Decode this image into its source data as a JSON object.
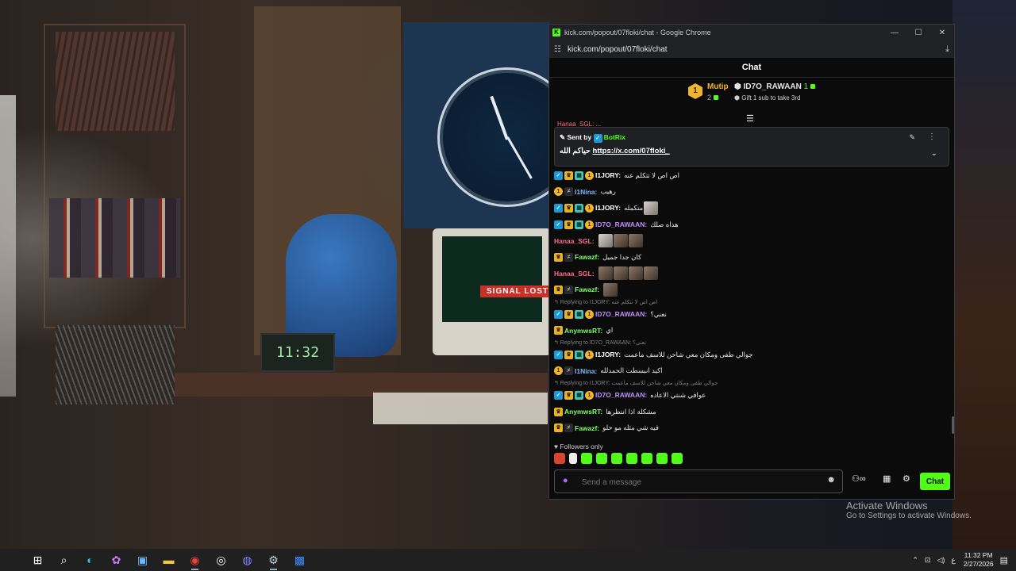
{
  "desktop": {
    "computer_sign": "SIGNAL LOST",
    "digital_clock": "11:32",
    "activate_title": "Activate Windows",
    "activate_sub": "Go to Settings to activate Windows."
  },
  "window": {
    "title": "kick.com/popout/07floki/chat - Google Chrome",
    "url": "kick.com/popout/07floki/chat",
    "controls": [
      "—",
      "☐",
      "✕"
    ]
  },
  "chat": {
    "header": "Chat",
    "leaderboard": {
      "first_rank": "1",
      "first_name": "Mutip",
      "first_count": "2",
      "second_name": "ID7O_RAWAAN",
      "second_count": "1",
      "gift_text": "Gift 1 sub to take 3rd"
    },
    "cut_text": "Hanaa_SGL: ...",
    "pinned": {
      "sent_by": "Sent by",
      "bot_name": "BotRix",
      "text_ar": "حياكم الله",
      "link": "https://x.com/07floki_"
    },
    "messages": [
      {
        "kind": "msg",
        "badges": [
          "verify",
          "crown",
          "gift",
          "coin"
        ],
        "user": "I1JORY:",
        "color": "#ffffff",
        "text": "اص اص لا تتكلم عنه"
      },
      {
        "kind": "msg",
        "badges": [
          "coin",
          "og"
        ],
        "user": "I1Nina:",
        "color": "#7fb8ff",
        "text": "رهيب"
      },
      {
        "kind": "msg",
        "badges": [
          "verify",
          "crown",
          "gift",
          "coin"
        ],
        "user": "I1JORY:",
        "color": "#ffffff",
        "text": "متكمله",
        "emotes": [
          "pale"
        ]
      },
      {
        "kind": "msg",
        "badges": [
          "verify",
          "crown",
          "gift",
          "coin"
        ],
        "user": "ID7O_RAWAAN:",
        "color": "#c08cff",
        "text": "هذاه صلك"
      },
      {
        "kind": "msg",
        "badges": [],
        "user": "Hanaa_SGL:",
        "color": "#ff6b8a",
        "text": "",
        "emotes": [
          "pale",
          "",
          ""
        ]
      },
      {
        "kind": "msg",
        "badges": [
          "crown",
          "og"
        ],
        "user": "Fawazf:",
        "color": "#7dff6a",
        "text": "كان جدا جميل"
      },
      {
        "kind": "msg",
        "badges": [],
        "user": "Hanaa_SGL:",
        "color": "#ff6b8a",
        "text": "",
        "emotes": [
          "",
          "",
          "",
          ""
        ]
      },
      {
        "kind": "msg",
        "badges": [
          "crown",
          "og"
        ],
        "user": "Fawazf:",
        "color": "#7dff6a",
        "text": "",
        "emotes": [
          ""
        ]
      },
      {
        "kind": "reply",
        "text": "↰ Replying to I1JORY: اص اص لا تتكلم عنه"
      },
      {
        "kind": "msg",
        "badges": [
          "verify",
          "crown",
          "gift",
          "coin"
        ],
        "user": "ID7O_RAWAAN:",
        "color": "#c08cff",
        "text": "نعني؟"
      },
      {
        "kind": "msg",
        "badges": [
          "crown"
        ],
        "user": "AnymwsRT:",
        "color": "#7dff6a",
        "text": "اي"
      },
      {
        "kind": "reply",
        "text": "↰ Replying to ID7O_RAWAAN: نعني؟"
      },
      {
        "kind": "msg",
        "badges": [
          "verify",
          "crown",
          "gift",
          "coin"
        ],
        "user": "I1JORY:",
        "color": "#ffffff",
        "text": "جوالي طفى ومكان معي شاحن للاسف ماعمت"
      },
      {
        "kind": "msg",
        "badges": [
          "coin",
          "og"
        ],
        "user": "I1Nina:",
        "color": "#7fb8ff",
        "text": "اكيد انبسطت الحمدلله"
      },
      {
        "kind": "reply",
        "text": "↰ Replying to I1JORY: جوالي طفى ومكان معي شاحن للاسف ماعمت"
      },
      {
        "kind": "msg",
        "badges": [
          "verify",
          "crown",
          "gift",
          "coin"
        ],
        "user": "ID7O_RAWAAN:",
        "color": "#c08cff",
        "text": "عوافي شنتي الاعاده"
      },
      {
        "kind": "msg",
        "badges": [
          "crown"
        ],
        "user": "AnymwsRT:",
        "color": "#7dff6a",
        "text": "مشكلة اذا انتظرها"
      },
      {
        "kind": "msg",
        "badges": [
          "crown",
          "og"
        ],
        "user": "Fawazf:",
        "color": "#7dff6a",
        "text": "فيه شي مثله مو حلو"
      }
    ],
    "followers_only": "Followers only",
    "input_placeholder": "Send a message",
    "send_label": "Chat"
  },
  "taskbar": {
    "time": "11:32 PM",
    "date": "2/27/2026",
    "lang": "ع"
  }
}
